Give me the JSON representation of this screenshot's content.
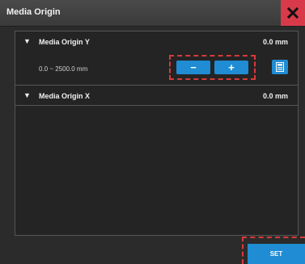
{
  "window": {
    "title": "Media Origin",
    "close_icon": "close-icon"
  },
  "rows": [
    {
      "expand_icon": "triangle-down-icon",
      "arrow": "▼",
      "label": "Media Origin Y",
      "value": "0.0 mm",
      "range": "0.0 ~ 2500.0 mm",
      "minus_label": "−",
      "plus_label": "+",
      "calculator_icon": "calculator-icon"
    },
    {
      "expand_icon": "triangle-down-icon",
      "arrow": "▼",
      "label": "Media Origin X",
      "value": "0.0 mm"
    }
  ],
  "footer": {
    "set_label": "SET"
  },
  "colors": {
    "accent": "#1f8cd4",
    "close": "#d93a4a",
    "highlight": "#d83a3a"
  }
}
